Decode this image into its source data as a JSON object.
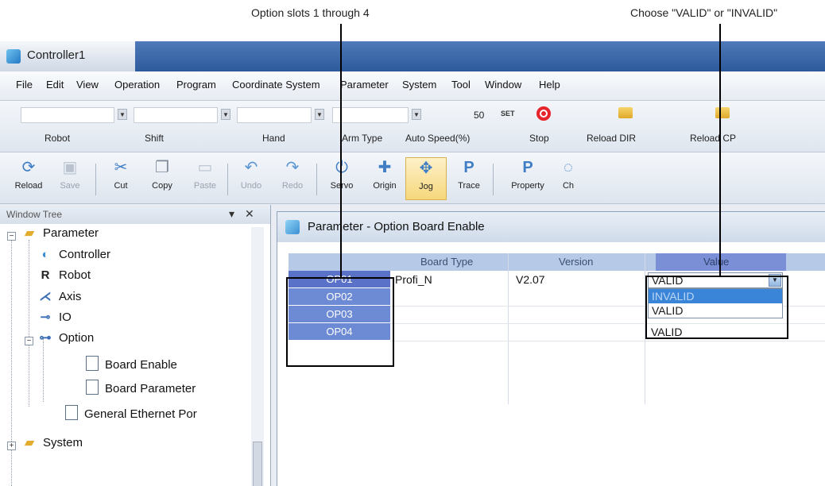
{
  "callouts": {
    "option_slots": "Option slots 1 through 4",
    "valid_choice": "Choose \"VALID\" or \"INVALID\""
  },
  "window": {
    "title": "Controller1"
  },
  "menu": [
    "File",
    "Edit",
    "View",
    "Operation",
    "Program",
    "Coordinate System",
    "Parameter",
    "System",
    "Tool",
    "Window",
    "Help"
  ],
  "selector_toolbar": {
    "robot_label": "Robot",
    "shift_label": "Shift",
    "hand_label": "Hand",
    "arm_type_label": "Arm Type",
    "auto_speed_label": "Auto Speed(%)",
    "auto_speed_value": "50",
    "set_label": "SET",
    "stop_label": "Stop",
    "reload_dir_label": "Reload DIR",
    "reload_cp_label": "Reload CP"
  },
  "command_toolbar": {
    "reload": "Reload",
    "save": "Save",
    "cut": "Cut",
    "copy": "Copy",
    "paste": "Paste",
    "undo": "Undo",
    "redo": "Redo",
    "servo": "Servo",
    "origin": "Origin",
    "jog": "Jog",
    "trace": "Trace",
    "property": "Property",
    "last": "Ch"
  },
  "tree": {
    "header": "Window Tree",
    "items": {
      "parameter": "Parameter",
      "controller": "Controller",
      "robot": "Robot",
      "axis": "Axis",
      "io": "IO",
      "option": "Option",
      "board_enable": "Board Enable",
      "board_parameter": "Board Parameter",
      "general_ethernet": "General Ethernet Por",
      "system": "System"
    }
  },
  "document": {
    "title": "Parameter - Option Board Enable",
    "columns": {
      "board_type": "Board Type",
      "version": "Version",
      "value": "Value"
    },
    "rows": [
      {
        "slot": "OP01",
        "board_type": "Profi_N",
        "version": "V2.07",
        "value": "VALID"
      },
      {
        "slot": "OP02",
        "board_type": "",
        "version": "",
        "value": ""
      },
      {
        "slot": "OP03",
        "board_type": "",
        "version": "",
        "value": ""
      },
      {
        "slot": "OP04",
        "board_type": "",
        "version": "",
        "value": "VALID"
      }
    ],
    "dropdown": {
      "selected": "VALID",
      "options": [
        "INVALID",
        "VALID"
      ],
      "highlighted": "INVALID"
    }
  },
  "colors": {
    "row_header": "#5f7ccc",
    "value_header": "#7b8fd6",
    "highlight": "#3b85d8"
  }
}
